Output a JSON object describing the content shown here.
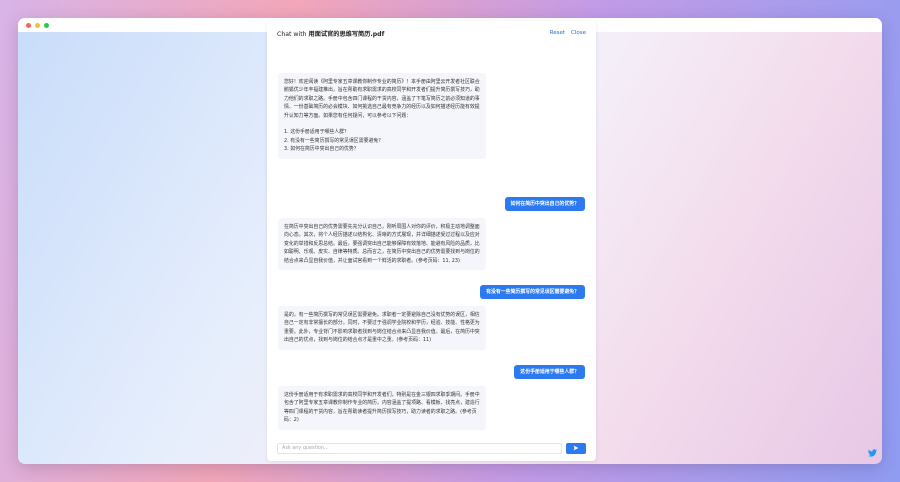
{
  "window": {
    "traffic_lights": {
      "close_color": "#ff5f57",
      "minimize_color": "#febc2e",
      "maximize_color": "#28c840"
    }
  },
  "header": {
    "prefix": "Chat with",
    "doc_name": "用面试官的思维写简历.pdf",
    "reset_label": "Reset",
    "close_label": "Close"
  },
  "messages": [
    {
      "role": "bot",
      "text": "您好！欢迎阅读《阿里专家五章课教你制作专业的简历》！本手册由阿里云开发者社区联合鹅狐优少年丰福建推出，旨在帮助有求职需求的高校同学和开发者们提升简历撰写技巧，助力他们的求职之路。手册中包含四门课程的干货内容，涵盖了下笔写简历之前必须知道的事情、一份基础简历的必会模块、如何挑选自己最有竞争力的经历以及如何描述经历能有效提升认知力等方面。如果您有任何疑问，可以参考以下问题：\n\n1. 这份手册适用于哪些人群？\n2. 有没有一些简历撰写的常见误区需要避免？\n3. 如何在简历中突出自己的优势？"
    },
    {
      "role": "user",
      "text": "如何在简历中突出自己的优势？"
    },
    {
      "role": "bot",
      "text": "在简历中突出自己的优势需要先充分认识自己，刚听周围人对你的评价，积极主动地调整面向心态。其次，将个人经历描述以结构化、清晰的方式展现，并详细描述受过过程以及应对变化的举措和反思总结。最后，要强调突出自己能够保障有效落地、能避有风险的品质，比如聪明、乐观、皮实、自律等特质。总而言之，在简历中突出自己的优势需要找到与岗位的结合点来凸显自我价值，并让面试官看到一个鲜活的求职者。(参考页码：11, 23)"
    },
    {
      "role": "user",
      "text": "有没有一些简历撰写的常见误区需要避免？"
    },
    {
      "role": "bot",
      "text": "是的，有一些简历撰写的常见误区需要避免。求职者一定要避除自己没有优势的误区，相信自己一定有非常擅长的部分。同时，不要过于强调学业院校和学历，经验、技能、性格更为重要。此外，专业背门不影响求职者找到与岗位结合点来凸显自我价值。最后，在简历中突出自己的优点，找到与岗位的结合点才是重中之重。(参考页码：11)"
    },
    {
      "role": "user",
      "text": "这份手册适用于哪些人群？"
    },
    {
      "role": "bot",
      "text": "这份手册适用于有求职需求的高校同学和开发者们，特别是在金三银四求职季期间。手册中包含了阿里专家五章课教你制作专业的简历，内容涵盖了提项路、看模板、找亮点，建造行等四门课程的干货内容，旨在帮助读者提升简历撰写技巧，助力读者的求职之路。(参考页码：2)"
    }
  ],
  "composer": {
    "placeholder": "Ask any question...",
    "send_icon": "send-icon"
  },
  "corner": {
    "icon": "twitter-icon",
    "color": "#1d9bf0"
  }
}
